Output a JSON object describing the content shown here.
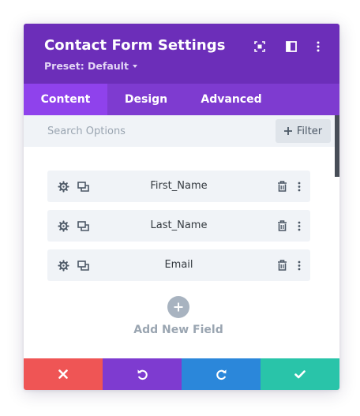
{
  "header": {
    "title": "Contact Form Settings",
    "preset_label": "Preset: Default",
    "icons": [
      "focus-icon",
      "sidebar-layout-icon",
      "more-vertical-icon"
    ]
  },
  "tabs": [
    {
      "label": "Content",
      "active": true
    },
    {
      "label": "Design",
      "active": false
    },
    {
      "label": "Advanced",
      "active": false
    }
  ],
  "search": {
    "placeholder": "Search Options",
    "value": "",
    "filter_label": "Filter",
    "filter_icon": "plus-icon"
  },
  "fields": [
    {
      "name": "First_Name"
    },
    {
      "name": "Last_Name"
    },
    {
      "name": "Email"
    }
  ],
  "field_icons": [
    "gear-icon",
    "duplicate-icon",
    "trash-icon",
    "more-vertical-icon"
  ],
  "add_field_label": "Add New Field",
  "footer": [
    {
      "action": "cancel",
      "icon": "close-icon",
      "color": "#ef5555"
    },
    {
      "action": "undo",
      "icon": "undo-icon",
      "color": "#7e3bd0"
    },
    {
      "action": "redo",
      "icon": "redo-icon",
      "color": "#2b87da"
    },
    {
      "action": "save",
      "icon": "check-icon",
      "color": "#29c4a9"
    }
  ],
  "colors": {
    "header": "#6c2eb9",
    "tabs": "#7e3bd0",
    "active_tab": "#8f42ec",
    "search_bg": "#f0f3f7"
  }
}
